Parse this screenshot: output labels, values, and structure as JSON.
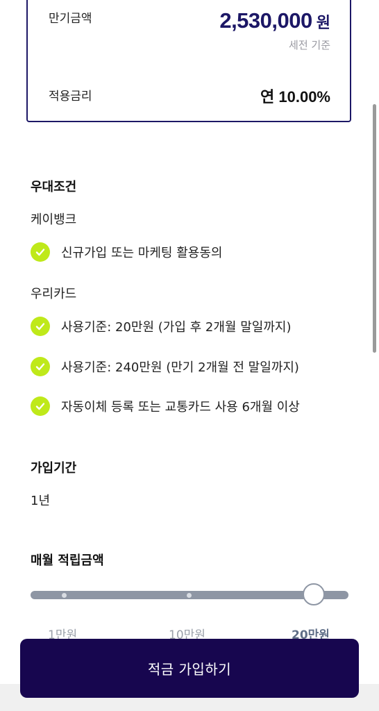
{
  "summary": {
    "maturity_label": "만기금액",
    "maturity_amount": "2,530,000",
    "maturity_unit": "원",
    "tax_note": "세전 기준",
    "rate_label": "적용금리",
    "rate_value": "연 10.00%"
  },
  "benefits": {
    "title": "우대조건",
    "groups": [
      {
        "provider": "케이뱅크",
        "conditions": [
          "신규가입 또는 마케팅 활용동의"
        ]
      },
      {
        "provider": "우리카드",
        "conditions": [
          "사용기준: 20만원 (가입 후 2개월 말일까지)",
          "사용기준: 240만원 (만기 2개월 전 말일까지)",
          "자동이체 등록 또는 교통카드 사용 6개월 이상"
        ]
      }
    ]
  },
  "period": {
    "title": "가입기간",
    "value": "1년"
  },
  "monthly": {
    "title": "매월 적립금액",
    "ticks": [
      "1만원",
      "10만원",
      "20만원"
    ],
    "selected": "20만원",
    "selected_fraction": 1.0
  },
  "cta": {
    "label": "적금 가입하기"
  },
  "colors": {
    "brand_navy": "#1c1766",
    "button_bg": "#17064f",
    "check_green": "#bfe91a",
    "slider_track": "#8e96a4"
  }
}
